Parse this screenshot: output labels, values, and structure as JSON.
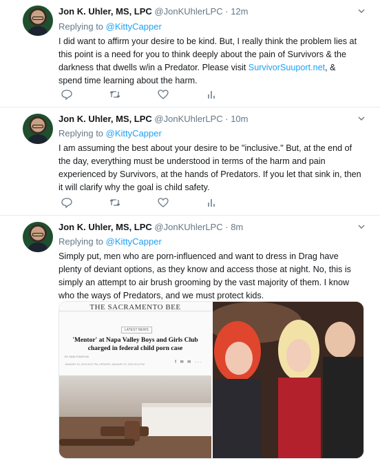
{
  "tweets": [
    {
      "name": "Jon K. Uhler, MS, LPC",
      "handle": "@JonKUhlerLPC",
      "dot": "·",
      "time": "12m",
      "replying_prefix": "Replying to",
      "replying_to": "@KittyCapper",
      "text_before_link": "I did want to affirm your desire to be kind. But, I really think the problem lies at this point is a need for you to think deeply about the pain of Survivors & the darkness that dwells w/in a Predator. Please visit ",
      "link": "SurvivorSuuport.net",
      "text_after_link": ", & spend time learning about the harm."
    },
    {
      "name": "Jon K. Uhler, MS, LPC",
      "handle": "@JonKUhlerLPC",
      "dot": "·",
      "time": "10m",
      "replying_prefix": "Replying to",
      "replying_to": "@KittyCapper",
      "text": "I am assuming the best about your desire to be \"inclusive.\" But, at the end of the day, everything must be understood in terms of the harm and pain experienced by Survivors, at the hands of Predators. If you let that sink in, then it will clarify why the goal is child safety."
    },
    {
      "name": "Jon K. Uhler, MS, LPC",
      "handle": "@JonKUhlerLPC",
      "dot": "·",
      "time": "8m",
      "replying_prefix": "Replying to",
      "replying_to": "@KittyCapper",
      "text": "Simply put, men who are porn-influenced and want to dress in Drag have plenty of deviant options, as they know and access those at night. No, this is simply an attempt to air brush grooming by the vast majority of them. I know who the ways of Predators, and we must protect kids."
    }
  ],
  "media": {
    "masthead": "THE SACRAMENTO BEE",
    "category": "LATEST NEWS",
    "headline": "'Mentor' at Napa Valley Boys and Girls Club charged in federal child porn case",
    "byline": "BY SAM STANTON",
    "dateline": "JANUARY 22, 2019 09:07 PM, UPDATED JANUARY 22, 2019 09:19 PM",
    "share_glyphs": "f ✉ ✉ ···"
  },
  "icons": {
    "reply": "reply-icon",
    "retweet": "retweet-icon",
    "like": "heart-icon",
    "analytics": "analytics-icon",
    "menu": "chevron-down-icon"
  },
  "colors": {
    "accent": "#1da1f2",
    "muted": "#657786",
    "divider": "#e6ecf0"
  }
}
